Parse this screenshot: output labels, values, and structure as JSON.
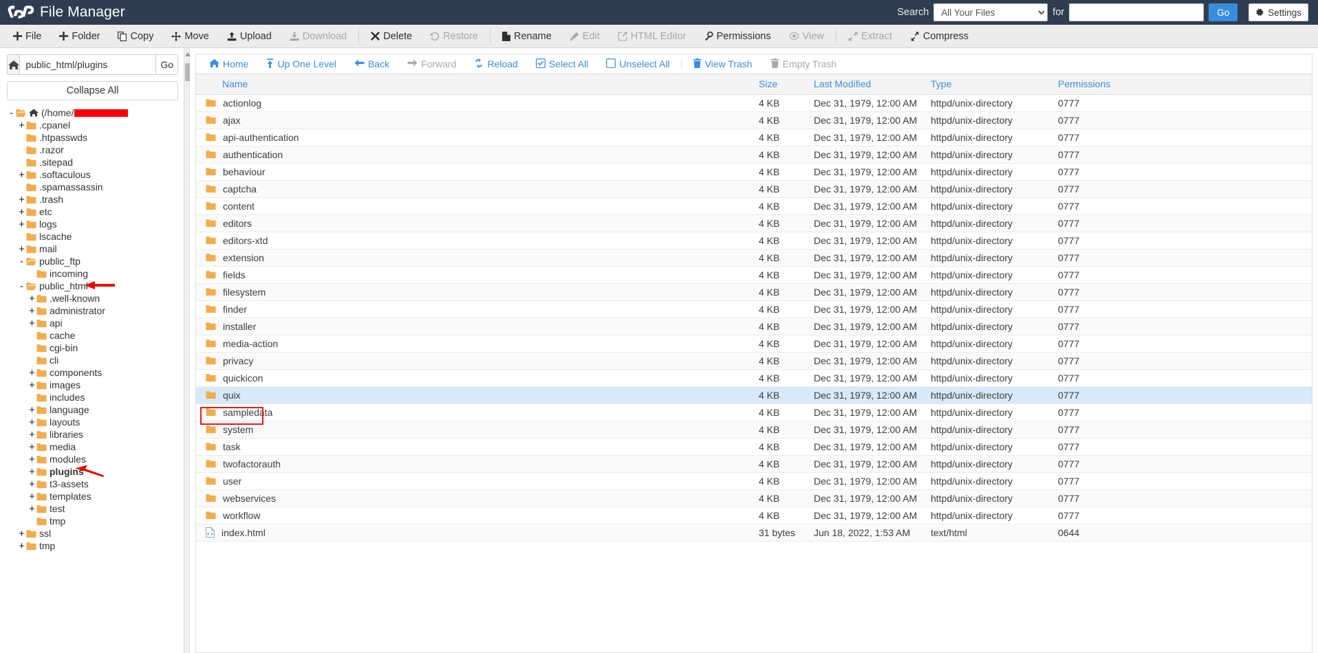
{
  "header": {
    "title": "File Manager",
    "logo_icon": "cpanel-logo-icon",
    "search_label": "Search",
    "search_scope_selected": "All Your Files",
    "search_scope_options": [
      "All Your Files"
    ],
    "for_label": "for",
    "search_value": "",
    "search_placeholder": "",
    "go_label": "Go",
    "settings_label": "Settings",
    "settings_icon": "gear-icon",
    "accent_color": "#3a8dde",
    "masthead_color": "#2e3e50"
  },
  "actionbar": {
    "items": [
      {
        "label": "File",
        "icon": "plus-icon",
        "disabled": false
      },
      {
        "label": "Folder",
        "icon": "plus-icon",
        "disabled": false
      },
      {
        "label": "Copy",
        "icon": "copy-icon",
        "disabled": false
      },
      {
        "label": "Move",
        "icon": "move-icon",
        "disabled": false
      },
      {
        "label": "Upload",
        "icon": "upload-icon",
        "disabled": false
      },
      {
        "label": "Download",
        "icon": "download-icon",
        "disabled": true
      },
      {
        "label": "Delete",
        "icon": "x-icon",
        "disabled": false
      },
      {
        "label": "Restore",
        "icon": "undo-icon",
        "disabled": true
      },
      {
        "label": "Rename",
        "icon": "file-icon",
        "disabled": false
      },
      {
        "label": "Edit",
        "icon": "pencil-icon",
        "disabled": true
      },
      {
        "label": "HTML Editor",
        "icon": "html-editor-icon",
        "disabled": true
      },
      {
        "label": "Permissions",
        "icon": "key-icon",
        "disabled": false
      },
      {
        "label": "View",
        "icon": "eye-icon",
        "disabled": true
      },
      {
        "label": "Extract",
        "icon": "extract-icon",
        "disabled": true
      },
      {
        "label": "Compress",
        "icon": "compress-icon",
        "disabled": false
      }
    ]
  },
  "sidebar": {
    "home_icon": "home-icon",
    "path_value": "public_html/plugins",
    "path_placeholder": "",
    "go_label": "Go",
    "collapse_all_label": "Collapse All",
    "tree": [
      {
        "label": "(/home/",
        "indent": 0,
        "toggle": "-",
        "open": true,
        "icon": "folder-open-home-icon",
        "redacted": true
      },
      {
        "label": ".cpanel",
        "indent": 1,
        "toggle": "+",
        "open": false,
        "icon": "folder-icon"
      },
      {
        "label": ".htpasswds",
        "indent": 1,
        "toggle": "",
        "open": false,
        "icon": "folder-icon"
      },
      {
        "label": ".razor",
        "indent": 1,
        "toggle": "",
        "open": false,
        "icon": "folder-icon"
      },
      {
        "label": ".sitepad",
        "indent": 1,
        "toggle": "",
        "open": false,
        "icon": "folder-icon"
      },
      {
        "label": ".softaculous",
        "indent": 1,
        "toggle": "+",
        "open": false,
        "icon": "folder-icon"
      },
      {
        "label": ".spamassassin",
        "indent": 1,
        "toggle": "",
        "open": false,
        "icon": "folder-icon"
      },
      {
        "label": ".trash",
        "indent": 1,
        "toggle": "+",
        "open": false,
        "icon": "folder-icon"
      },
      {
        "label": "etc",
        "indent": 1,
        "toggle": "+",
        "open": false,
        "icon": "folder-icon"
      },
      {
        "label": "logs",
        "indent": 1,
        "toggle": "+",
        "open": false,
        "icon": "folder-icon"
      },
      {
        "label": "lscache",
        "indent": 1,
        "toggle": "",
        "open": false,
        "icon": "folder-icon"
      },
      {
        "label": "mail",
        "indent": 1,
        "toggle": "+",
        "open": false,
        "icon": "folder-icon"
      },
      {
        "label": "public_ftp",
        "indent": 1,
        "toggle": "-",
        "open": true,
        "icon": "folder-open-icon"
      },
      {
        "label": "incoming",
        "indent": 2,
        "toggle": "",
        "open": false,
        "icon": "folder-icon"
      },
      {
        "label": "public_html",
        "indent": 1,
        "toggle": "-",
        "open": true,
        "icon": "folder-open-icon",
        "arrow": true
      },
      {
        "label": ".well-known",
        "indent": 2,
        "toggle": "+",
        "open": false,
        "icon": "folder-icon"
      },
      {
        "label": "administrator",
        "indent": 2,
        "toggle": "+",
        "open": false,
        "icon": "folder-icon"
      },
      {
        "label": "api",
        "indent": 2,
        "toggle": "+",
        "open": false,
        "icon": "folder-icon"
      },
      {
        "label": "cache",
        "indent": 2,
        "toggle": "",
        "open": false,
        "icon": "folder-icon"
      },
      {
        "label": "cgi-bin",
        "indent": 2,
        "toggle": "",
        "open": false,
        "icon": "folder-icon"
      },
      {
        "label": "cli",
        "indent": 2,
        "toggle": "",
        "open": false,
        "icon": "folder-icon"
      },
      {
        "label": "components",
        "indent": 2,
        "toggle": "+",
        "open": false,
        "icon": "folder-icon"
      },
      {
        "label": "images",
        "indent": 2,
        "toggle": "+",
        "open": false,
        "icon": "folder-icon"
      },
      {
        "label": "includes",
        "indent": 2,
        "toggle": "",
        "open": false,
        "icon": "folder-icon"
      },
      {
        "label": "language",
        "indent": 2,
        "toggle": "+",
        "open": false,
        "icon": "folder-icon"
      },
      {
        "label": "layouts",
        "indent": 2,
        "toggle": "+",
        "open": false,
        "icon": "folder-icon"
      },
      {
        "label": "libraries",
        "indent": 2,
        "toggle": "+",
        "open": false,
        "icon": "folder-icon"
      },
      {
        "label": "media",
        "indent": 2,
        "toggle": "+",
        "open": false,
        "icon": "folder-icon"
      },
      {
        "label": "modules",
        "indent": 2,
        "toggle": "+",
        "open": false,
        "icon": "folder-icon"
      },
      {
        "label": "plugins",
        "indent": 2,
        "toggle": "+",
        "open": false,
        "icon": "folder-icon",
        "bold": true,
        "arrow": true
      },
      {
        "label": "t3-assets",
        "indent": 2,
        "toggle": "+",
        "open": false,
        "icon": "folder-icon"
      },
      {
        "label": "templates",
        "indent": 2,
        "toggle": "+",
        "open": false,
        "icon": "folder-icon"
      },
      {
        "label": "test",
        "indent": 2,
        "toggle": "+",
        "open": false,
        "icon": "folder-icon"
      },
      {
        "label": "tmp",
        "indent": 2,
        "toggle": "",
        "open": false,
        "icon": "folder-icon"
      },
      {
        "label": "ssl",
        "indent": 1,
        "toggle": "+",
        "open": false,
        "icon": "folder-icon"
      },
      {
        "label": "tmp",
        "indent": 1,
        "toggle": "+",
        "open": false,
        "icon": "folder-icon"
      }
    ]
  },
  "navbar": {
    "items": [
      {
        "label": "Home",
        "icon": "home-icon",
        "disabled": false
      },
      {
        "label": "Up One Level",
        "icon": "up-arrow-icon",
        "disabled": false
      },
      {
        "label": "Back",
        "icon": "arrow-left-icon",
        "disabled": false
      },
      {
        "label": "Forward",
        "icon": "arrow-right-icon",
        "disabled": true
      },
      {
        "label": "Reload",
        "icon": "reload-icon",
        "disabled": false
      },
      {
        "label": "Select All",
        "icon": "checkbox-checked-icon",
        "disabled": false
      },
      {
        "label": "Unselect All",
        "icon": "checkbox-empty-icon",
        "disabled": false
      },
      {
        "label": "View Trash",
        "icon": "trash-icon",
        "disabled": false,
        "after_sep": true
      },
      {
        "label": "Empty Trash",
        "icon": "trash-icon",
        "disabled": true
      }
    ]
  },
  "filetable": {
    "columns": [
      "Name",
      "Size",
      "Last Modified",
      "Type",
      "Permissions"
    ],
    "rows": [
      {
        "name": "actionlog",
        "size": "4 KB",
        "modified": "Dec 31, 1979, 12:00 AM",
        "type": "httpd/unix-directory",
        "perms": "0777",
        "icon": "folder-icon",
        "selected": false
      },
      {
        "name": "ajax",
        "size": "4 KB",
        "modified": "Dec 31, 1979, 12:00 AM",
        "type": "httpd/unix-directory",
        "perms": "0777",
        "icon": "folder-icon",
        "selected": false
      },
      {
        "name": "api-authentication",
        "size": "4 KB",
        "modified": "Dec 31, 1979, 12:00 AM",
        "type": "httpd/unix-directory",
        "perms": "0777",
        "icon": "folder-icon",
        "selected": false
      },
      {
        "name": "authentication",
        "size": "4 KB",
        "modified": "Dec 31, 1979, 12:00 AM",
        "type": "httpd/unix-directory",
        "perms": "0777",
        "icon": "folder-icon",
        "selected": false
      },
      {
        "name": "behaviour",
        "size": "4 KB",
        "modified": "Dec 31, 1979, 12:00 AM",
        "type": "httpd/unix-directory",
        "perms": "0777",
        "icon": "folder-icon",
        "selected": false
      },
      {
        "name": "captcha",
        "size": "4 KB",
        "modified": "Dec 31, 1979, 12:00 AM",
        "type": "httpd/unix-directory",
        "perms": "0777",
        "icon": "folder-icon",
        "selected": false
      },
      {
        "name": "content",
        "size": "4 KB",
        "modified": "Dec 31, 1979, 12:00 AM",
        "type": "httpd/unix-directory",
        "perms": "0777",
        "icon": "folder-icon",
        "selected": false
      },
      {
        "name": "editors",
        "size": "4 KB",
        "modified": "Dec 31, 1979, 12:00 AM",
        "type": "httpd/unix-directory",
        "perms": "0777",
        "icon": "folder-icon",
        "selected": false
      },
      {
        "name": "editors-xtd",
        "size": "4 KB",
        "modified": "Dec 31, 1979, 12:00 AM",
        "type": "httpd/unix-directory",
        "perms": "0777",
        "icon": "folder-icon",
        "selected": false
      },
      {
        "name": "extension",
        "size": "4 KB",
        "modified": "Dec 31, 1979, 12:00 AM",
        "type": "httpd/unix-directory",
        "perms": "0777",
        "icon": "folder-icon",
        "selected": false
      },
      {
        "name": "fields",
        "size": "4 KB",
        "modified": "Dec 31, 1979, 12:00 AM",
        "type": "httpd/unix-directory",
        "perms": "0777",
        "icon": "folder-icon",
        "selected": false
      },
      {
        "name": "filesystem",
        "size": "4 KB",
        "modified": "Dec 31, 1979, 12:00 AM",
        "type": "httpd/unix-directory",
        "perms": "0777",
        "icon": "folder-icon",
        "selected": false
      },
      {
        "name": "finder",
        "size": "4 KB",
        "modified": "Dec 31, 1979, 12:00 AM",
        "type": "httpd/unix-directory",
        "perms": "0777",
        "icon": "folder-icon",
        "selected": false
      },
      {
        "name": "installer",
        "size": "4 KB",
        "modified": "Dec 31, 1979, 12:00 AM",
        "type": "httpd/unix-directory",
        "perms": "0777",
        "icon": "folder-icon",
        "selected": false
      },
      {
        "name": "media-action",
        "size": "4 KB",
        "modified": "Dec 31, 1979, 12:00 AM",
        "type": "httpd/unix-directory",
        "perms": "0777",
        "icon": "folder-icon",
        "selected": false
      },
      {
        "name": "privacy",
        "size": "4 KB",
        "modified": "Dec 31, 1979, 12:00 AM",
        "type": "httpd/unix-directory",
        "perms": "0777",
        "icon": "folder-icon",
        "selected": false
      },
      {
        "name": "quickicon",
        "size": "4 KB",
        "modified": "Dec 31, 1979, 12:00 AM",
        "type": "httpd/unix-directory",
        "perms": "0777",
        "icon": "folder-icon",
        "selected": false
      },
      {
        "name": "quix",
        "size": "4 KB",
        "modified": "Dec 31, 1979, 12:00 AM",
        "type": "httpd/unix-directory",
        "perms": "0777",
        "icon": "folder-icon",
        "selected": true
      },
      {
        "name": "sampledata",
        "size": "4 KB",
        "modified": "Dec 31, 1979, 12:00 AM",
        "type": "httpd/unix-directory",
        "perms": "0777",
        "icon": "folder-icon",
        "selected": false
      },
      {
        "name": "system",
        "size": "4 KB",
        "modified": "Dec 31, 1979, 12:00 AM",
        "type": "httpd/unix-directory",
        "perms": "0777",
        "icon": "folder-icon",
        "selected": false
      },
      {
        "name": "task",
        "size": "4 KB",
        "modified": "Dec 31, 1979, 12:00 AM",
        "type": "httpd/unix-directory",
        "perms": "0777",
        "icon": "folder-icon",
        "selected": false
      },
      {
        "name": "twofactorauth",
        "size": "4 KB",
        "modified": "Dec 31, 1979, 12:00 AM",
        "type": "httpd/unix-directory",
        "perms": "0777",
        "icon": "folder-icon",
        "selected": false
      },
      {
        "name": "user",
        "size": "4 KB",
        "modified": "Dec 31, 1979, 12:00 AM",
        "type": "httpd/unix-directory",
        "perms": "0777",
        "icon": "folder-icon",
        "selected": false
      },
      {
        "name": "webservices",
        "size": "4 KB",
        "modified": "Dec 31, 1979, 12:00 AM",
        "type": "httpd/unix-directory",
        "perms": "0777",
        "icon": "folder-icon",
        "selected": false
      },
      {
        "name": "workflow",
        "size": "4 KB",
        "modified": "Dec 31, 1979, 12:00 AM",
        "type": "httpd/unix-directory",
        "perms": "0777",
        "icon": "folder-icon",
        "selected": false
      },
      {
        "name": "index.html",
        "size": "31 bytes",
        "modified": "Jun 18, 2022, 1:53 AM",
        "type": "text/html",
        "perms": "0644",
        "icon": "html-file-icon",
        "selected": false
      }
    ]
  },
  "annotations": {
    "selected_row_box_color": "#e81b14",
    "arrow_color": "#ee0000"
  }
}
